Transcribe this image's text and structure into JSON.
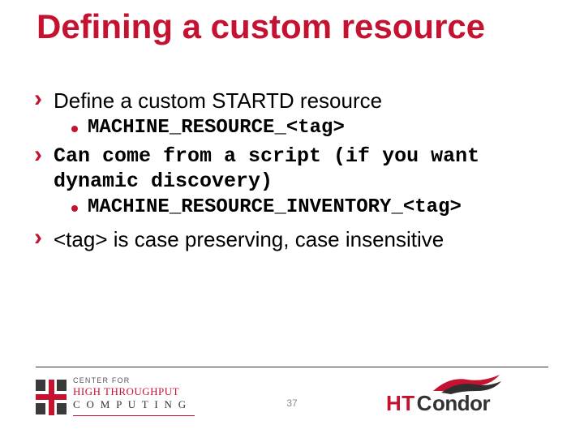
{
  "title": "Defining a custom resource",
  "bullets": {
    "b1": "Define a custom STARTD resource",
    "b1_sub": "MACHINE_RESOURCE_<tag>",
    "b2": "Can come from a script (if you want dynamic discovery)",
    "b2_sub": "MACHINE_RESOURCE_INVENTORY_<tag>",
    "b3": "<tag> is case preserving, case insensitive"
  },
  "footer": {
    "page": "37",
    "chtc": {
      "line1": "CENTER FOR",
      "line2": "HIGH THROUGHPUT",
      "line3": "C O M P U T I N G"
    },
    "htcondor": {
      "ht": "HT",
      "c": "C",
      "ondor": "ondor"
    }
  }
}
